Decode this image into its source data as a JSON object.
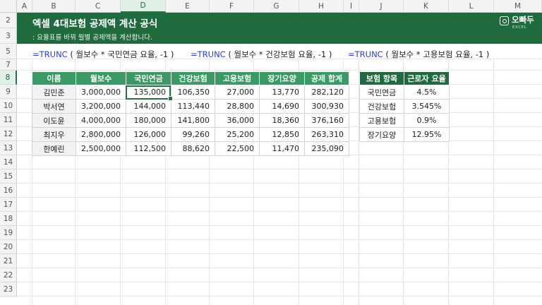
{
  "columns": [
    "A",
    "B",
    "C",
    "D",
    "E",
    "F",
    "G",
    "H",
    "I",
    "J",
    "K",
    "L",
    "M"
  ],
  "selected_column": "D",
  "rows": [
    "2",
    "3",
    "5",
    "7",
    "8",
    "9",
    "10",
    "11",
    "12",
    "13",
    "14",
    "15",
    "16",
    "17",
    "18",
    "19",
    "20",
    "21",
    "22",
    "23"
  ],
  "selected_row": "8",
  "banner": {
    "title": "엑셀 4대보험 공제액 계산 공식",
    "subtitle": ": 요율표를 바꿔 월별 공제액을 계산합니다.",
    "logo_text": "오빠두",
    "logo_sub": "EXCEL",
    "bg_color": "#1f6b3d"
  },
  "formulas": [
    {
      "fn": "=TRUNC",
      "args": "( 월보수 * 국민연금 요율, -1 )"
    },
    {
      "fn": "=TRUNC",
      "args": "( 월보수 * 건강보험 요율, -1 )"
    },
    {
      "fn": "=TRUNC",
      "args": "( 월보수 * 고용보험 요율, -1 )"
    }
  ],
  "main_table": {
    "headers": [
      "이름",
      "월보수",
      "국민연금",
      "건강보험",
      "고용보험",
      "장기요양",
      "공제 합계"
    ],
    "rows": [
      [
        "김민준",
        "3,000,000",
        "135,000",
        "106,350",
        "27,000",
        "13,770",
        "282,120"
      ],
      [
        "박서연",
        "3,200,000",
        "144,000",
        "113,440",
        "28,800",
        "14,690",
        "300,930"
      ],
      [
        "이도윤",
        "4,000,000",
        "180,000",
        "141,800",
        "36,000",
        "18,360",
        "376,160"
      ],
      [
        "최지우",
        "2,800,000",
        "126,000",
        "99,260",
        "25,200",
        "12,850",
        "263,310"
      ],
      [
        "한예린",
        "2,500,000",
        "112,500",
        "88,620",
        "22,500",
        "11,470",
        "235,090"
      ]
    ],
    "header_color": "#3a9a63"
  },
  "rate_table": {
    "headers": [
      "보험 항목",
      "근로자 요율"
    ],
    "rows": [
      [
        "국민연금",
        "4.5%"
      ],
      [
        "건강보험",
        "3.545%"
      ],
      [
        "고용보험",
        "0.9%"
      ],
      [
        "장기요양",
        "12.95%"
      ]
    ],
    "header_color": "#1f6b3d"
  }
}
